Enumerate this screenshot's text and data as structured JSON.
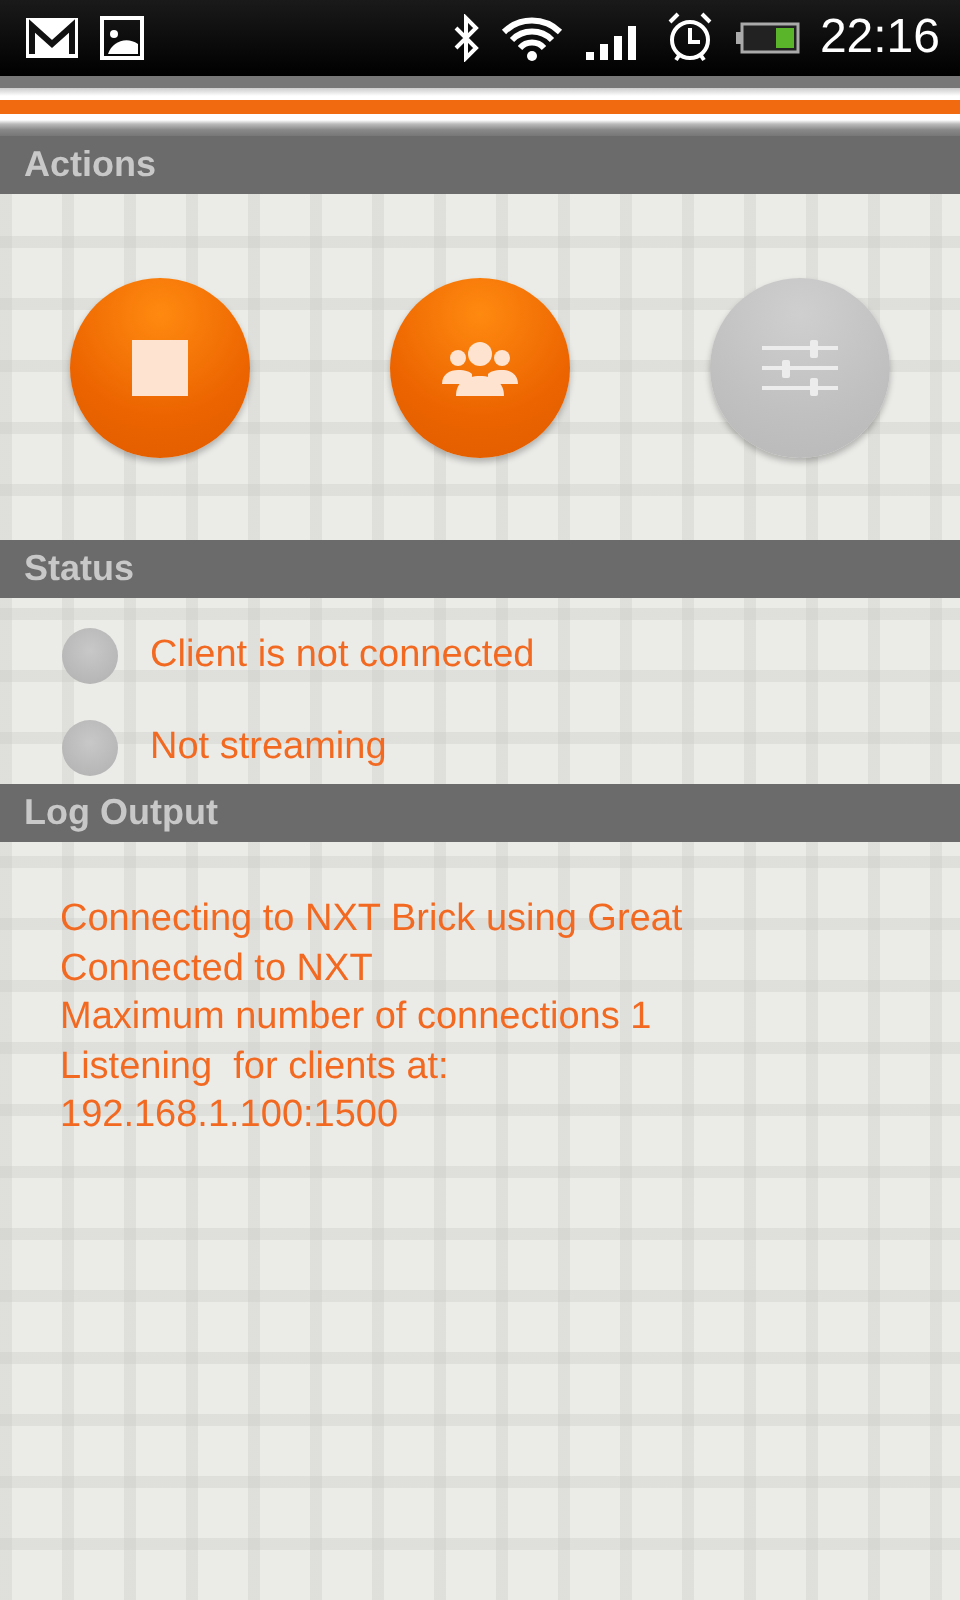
{
  "status_bar": {
    "time": "22:16"
  },
  "sections": [
    {
      "kind": "actions",
      "title": "Actions",
      "buttons": [
        {
          "kind": "stop",
          "enabled": true
        },
        {
          "kind": "clients",
          "enabled": true
        },
        {
          "kind": "settings",
          "enabled": false
        }
      ]
    },
    {
      "kind": "status",
      "title": "Status",
      "items": [
        {
          "label": "Client is not connected",
          "on": false
        },
        {
          "label": "Not streaming",
          "on": false
        }
      ]
    },
    {
      "kind": "log",
      "title": "Log Output",
      "lines": [
        "Connecting to NXT Brick using Great",
        "Connected to NXT",
        "Maximum number of connections 1",
        "Listening  for clients at:",
        "192.168.1.100:1500"
      ]
    }
  ]
}
